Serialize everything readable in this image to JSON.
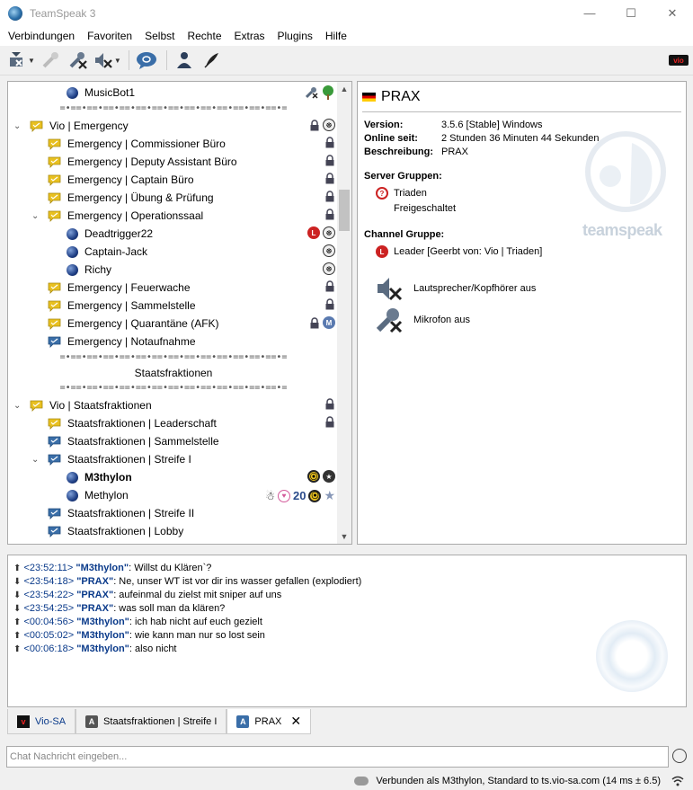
{
  "window": {
    "title": "TeamSpeak 3",
    "minimize": "—",
    "maximize": "☐",
    "close": "✕"
  },
  "menu": [
    "Verbindungen",
    "Favoriten",
    "Selbst",
    "Rechte",
    "Extras",
    "Plugins",
    "Hilfe"
  ],
  "tree": {
    "musicbot": "MusicBot1",
    "spacer": "=•==•==•==•==•==•==•==•==•==•==•==•==•==•=",
    "vio_emergency": "Vio | Emergency",
    "emergency_channels": [
      "Emergency | Commissioner Büro",
      "Emergency | Deputy Assistant Büro",
      "Emergency | Captain Büro",
      "Emergency | Übung & Prüfung",
      "Emergency | Operationssaal"
    ],
    "operationssaal_users": [
      "Deadtrigger22",
      "Captain-Jack",
      "Richy"
    ],
    "emergency_channels2": [
      "Emergency | Feuerwache",
      "Emergency | Sammelstelle",
      "Emergency | Quarantäne (AFK)",
      "Emergency | Notaufnahme"
    ],
    "spacer_title": "Staatsfraktionen",
    "vio_staatsfraktionen": "Vio | Staatsfraktionen",
    "staats_channels": [
      "Staatsfraktionen | Leaderschaft",
      "Staatsfraktionen | Sammelstelle",
      "Staatsfraktionen | Streife I"
    ],
    "streife_users": [
      "M3thylon",
      "Methylon"
    ],
    "staats_channels2": [
      "Staatsfraktionen | Streife II",
      "Staatsfraktionen | Lobby"
    ],
    "badge_20": "20"
  },
  "info": {
    "name": "PRAX",
    "version_label": "Version:",
    "version_value": "3.5.6 [Stable] Windows",
    "online_label": "Online seit:",
    "online_value": "2 Stunden 36 Minuten 44 Sekunden",
    "desc_label": "Beschreibung:",
    "desc_value": "PRAX",
    "server_groups_label": "Server Gruppen:",
    "server_groups": [
      "Triaden",
      "Freigeschaltet"
    ],
    "channel_group_label": "Channel Gruppe:",
    "channel_group": "Leader [Geerbt von: Vio | Triaden]",
    "speakers_off": "Lautsprecher/Kopfhörer aus",
    "mic_off": "Mikrofon aus",
    "watermark": "teamspeak"
  },
  "chat": [
    {
      "dir": "up",
      "ts": "<23:52:11>",
      "nick": "\"M3thylon\"",
      "msg": ": Willst du Klären`?"
    },
    {
      "dir": "down",
      "ts": "<23:54:18>",
      "nick": "\"PRAX\"",
      "msg": ": Ne, unser WT ist vor dir ins wasser gefallen (explodiert)"
    },
    {
      "dir": "down",
      "ts": "<23:54:22>",
      "nick": "\"PRAX\"",
      "msg": ": aufeinmal du zielst mit sniper auf uns"
    },
    {
      "dir": "down",
      "ts": "<23:54:25>",
      "nick": "\"PRAX\"",
      "msg": ": was soll man da klären?"
    },
    {
      "dir": "up",
      "ts": "<00:04:56>",
      "nick": "\"M3thylon\"",
      "msg": ": ich hab nicht auf euch gezielt"
    },
    {
      "dir": "up",
      "ts": "<00:05:02>",
      "nick": "\"M3thylon\"",
      "msg": ": wie kann man nur so lost sein"
    },
    {
      "dir": "up",
      "ts": "<00:06:18>",
      "nick": "\"M3thylon\"",
      "msg": ": also nicht"
    }
  ],
  "tabs": [
    "Vio-SA",
    "Staatsfraktionen | Streife I",
    "PRAX"
  ],
  "tab_close": "✕",
  "input": {
    "placeholder": "Chat Nachricht eingeben..."
  },
  "status": "Verbunden als M3thylon, Standard to ts.vio-sa.com (14 ms ± 6.5)",
  "toolbar": {
    "vio_logo": "vio"
  },
  "colors": {
    "accent": "#0a3a8a",
    "channel_yellow": "#e8c020",
    "channel_blue": "#3a6ea8"
  }
}
